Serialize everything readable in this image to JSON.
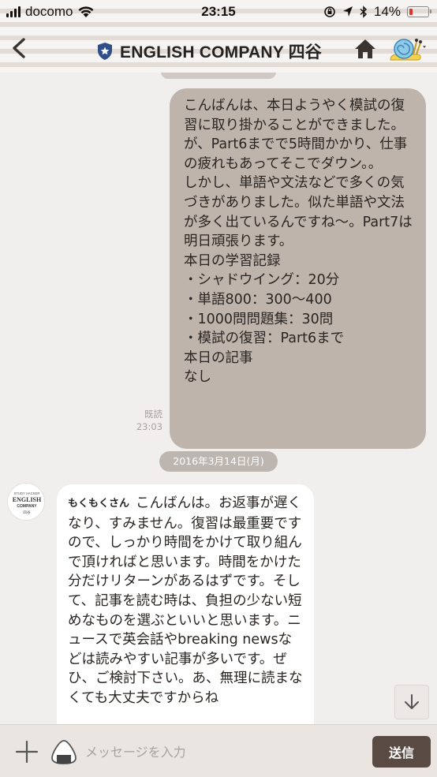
{
  "status_bar": {
    "carrier": "docomo",
    "time": "23:15",
    "battery_text": "14%",
    "battery_level_percent": 14,
    "icons": [
      "signal-icon",
      "wifi-icon",
      "rotation-lock-icon",
      "location-icon",
      "bluetooth-icon",
      "battery-icon"
    ]
  },
  "header": {
    "title": "ENGLISH COMPANY 四谷",
    "icons": [
      "back-chevron-icon",
      "official-shield-icon",
      "home-icon",
      "snail-icon",
      "caret-down-icon"
    ]
  },
  "messages": [
    {
      "direction": "outgoing",
      "text": "こんばんは、本日ようやく模試の復習に取り掛かることができました。が、Part6までで5時間かかり、仕事の疲れもあってそこでダウン。。\nしかし、単語や文法などで多くの気づきがありました。似た単語や文法が多く出ているんですね〜。Part7は明日頑張ります。\n本日の学習記録\n・シャドウイング：20分\n・単語800：300〜400\n・1000問問題集：30問\n・模試の復習：Part6まで\n本日の記事\nなし",
      "read_label": "既読",
      "time": "23:03"
    },
    {
      "direction": "incoming",
      "sender": "もくもくさん",
      "text": "こんばんは。お返事が遅くなり、すみません。復習は最重要ですので、しっかり時間をかけて取り組んで頂ければと思います。時間をかけた分だけリターンがあるはずです。そして、記事を読む時は、負担の少ない短めなものを選ぶといいと思います。ニュースで英会話やbreaking newsなどは読みやすい記事が多いです。ぜひ、ご検討下さい。あ、無理に読まなくても大丈夫ですからね"
    }
  ],
  "date_divider": "2016年3月14日(月)",
  "avatar": {
    "line1": "STUDY HACKER",
    "line2": "ENGLISH",
    "line3": "COMPANY",
    "line4": "四谷"
  },
  "input": {
    "placeholder": "メッセージを入力",
    "value": "",
    "send_label": "送信"
  },
  "colors": {
    "outgoing_bubble": "#bfb4ac",
    "incoming_bubble": "#ffffff",
    "chat_background": "#f1efed",
    "send_button": "#5a4a44",
    "badge_blue": "#2f4f8a",
    "battery_red": "#e0352b"
  }
}
